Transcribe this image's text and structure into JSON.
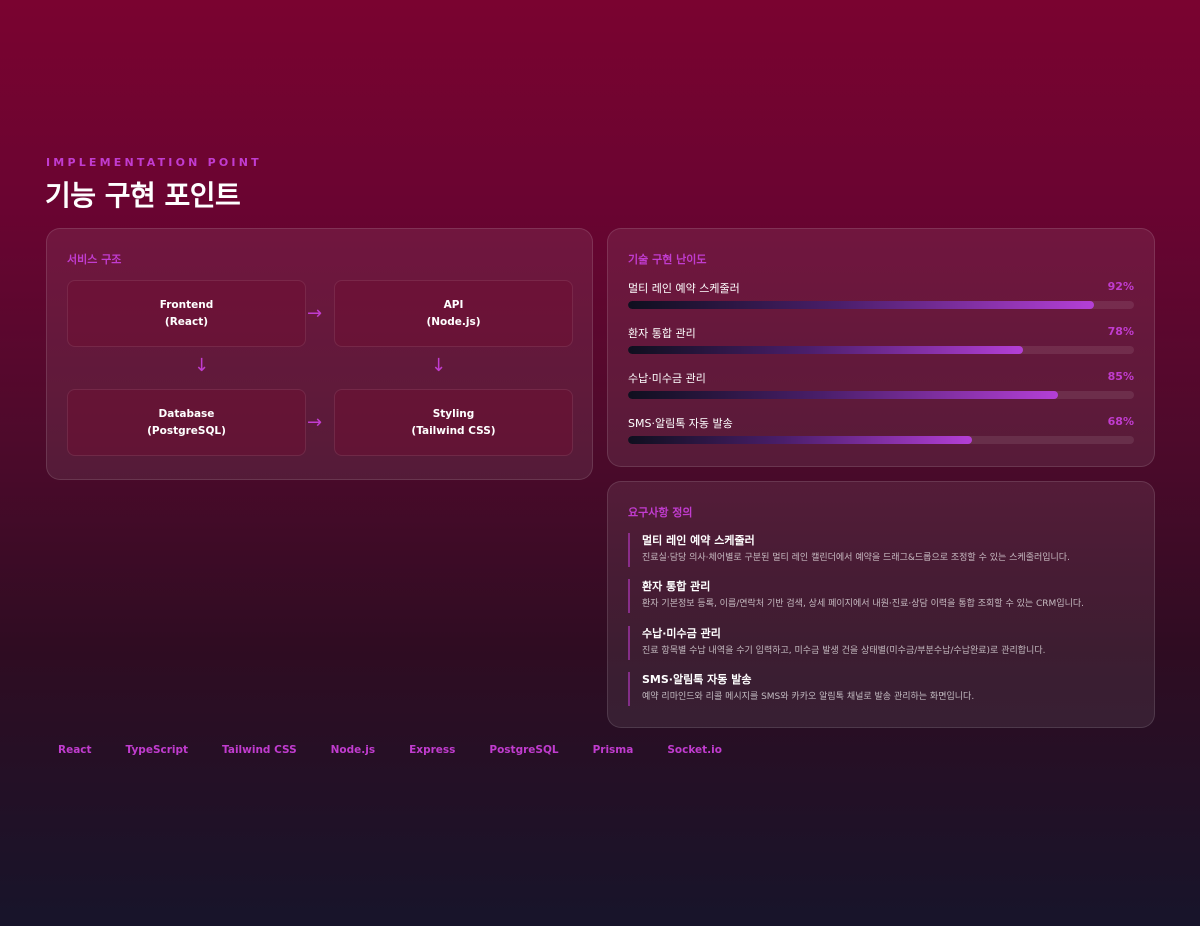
{
  "header": {
    "eyebrow": "IMPLEMENTATION POINT",
    "title": "기능 구현 포인트"
  },
  "architecture": {
    "title": "서비스 구조",
    "boxes": [
      {
        "name": "Frontend",
        "tech": "(React)"
      },
      {
        "name": "API",
        "tech": "(Node.js)"
      },
      {
        "name": "Database",
        "tech": "(PostgreSQL)"
      },
      {
        "name": "Styling",
        "tech": "(Tailwind CSS)"
      }
    ],
    "arrow_right": "→",
    "arrow_down": "↓"
  },
  "difficulty": {
    "title": "기술 구현 난이도",
    "items": [
      {
        "label": "멀티 레인 예약 스케줄러",
        "value": 92,
        "value_text": "92%"
      },
      {
        "label": "환자 통합 관리",
        "value": 78,
        "value_text": "78%"
      },
      {
        "label": "수납·미수금 관리",
        "value": 85,
        "value_text": "85%"
      },
      {
        "label": "SMS·알림톡 자동 발송",
        "value": 68,
        "value_text": "68%"
      }
    ]
  },
  "requirements": {
    "title": "요구사항 정의",
    "items": [
      {
        "title": "멀티 레인 예약 스케줄러",
        "desc": "진료실·담당 의사·체어별로 구분된 멀티 레인 캘린더에서 예약을 드래그&드롭으로 조정할 수 있는 스케줄러입니다."
      },
      {
        "title": "환자 통합 관리",
        "desc": "환자 기본정보 등록, 이름/연락처 기반 검색, 상세 페이지에서 내원·진료·상담 이력을 통합 조회할 수 있는 CRM입니다."
      },
      {
        "title": "수납·미수금 관리",
        "desc": "진료 항목별 수납 내역을 수기 입력하고, 미수금 발생 건을 상태별(미수금/부분수납/수납완료)로 관리합니다."
      },
      {
        "title": "SMS·알림톡 자동 발송",
        "desc": "예약 리마인드와 리콜 메시지를 SMS와 카카오 알림톡 채널로 발송 관리하는 화면입니다."
      }
    ]
  },
  "tech_stack": [
    "React",
    "TypeScript",
    "Tailwind CSS",
    "Node.js",
    "Express",
    "PostgreSQL",
    "Prisma",
    "Socket.io"
  ],
  "colors": {
    "accent": "#c13ccf",
    "bar_gradient_start": "#0f0f1e",
    "bar_gradient_end": "#b43fd6"
  }
}
